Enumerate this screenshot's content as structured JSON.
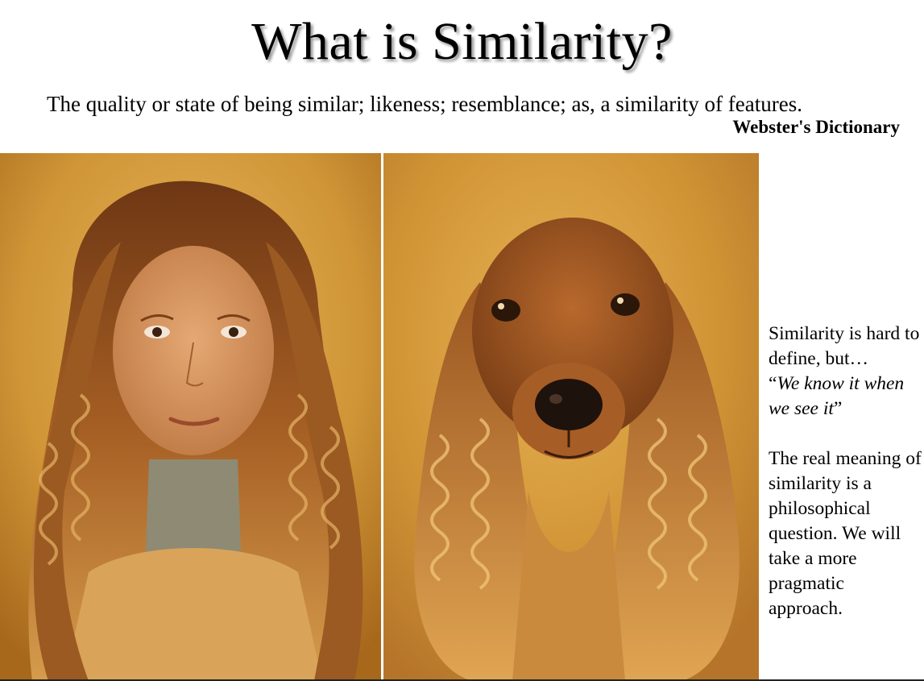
{
  "slide": {
    "title": "What is Similarity?",
    "definition": "The quality or state of being similar; likeness; resemblance; as, a similarity of features.",
    "source": "Webster's Dictionary"
  },
  "images": {
    "left": "woman-with-curly-hair-photo",
    "right": "cocker-spaniel-dog-photo"
  },
  "sidebar": {
    "line1": "Similarity is hard to define, but…",
    "quote_open": "“",
    "quote_text": "We know it when we see it",
    "quote_close": "”",
    "paragraph2": "The real meaning of similarity is a philosophical question. We will take a more pragmatic approach."
  }
}
